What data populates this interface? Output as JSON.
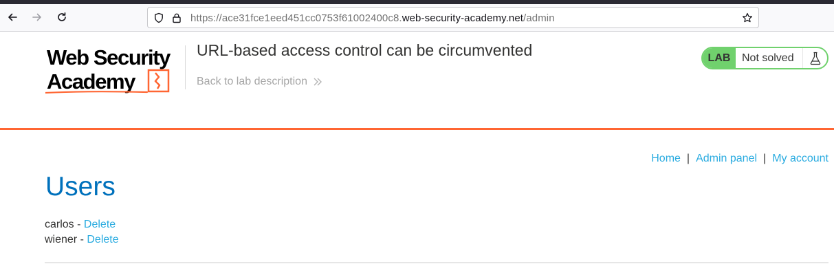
{
  "browser": {
    "url_prefix": "https://ace31fce1eed451cc0753f61002400c8.",
    "url_host": "web-security-academy.net",
    "url_path": "/admin",
    "icons": [
      "back-arrow-icon",
      "forward-arrow-icon",
      "reload-icon",
      "shield-icon",
      "lock-icon",
      "star-icon"
    ]
  },
  "header": {
    "logo_line1": "Web Security",
    "logo_line2": "Academy",
    "lab_title": "URL-based access control can be circumvented",
    "back_link": "Back to lab description",
    "status_badge": "LAB",
    "status_text": "Not solved"
  },
  "nav": {
    "home": "Home",
    "separator": "|",
    "admin": "Admin panel",
    "account": "My account"
  },
  "main": {
    "heading": "Users",
    "users": [
      {
        "name": "carlos",
        "dash": " - ",
        "action": "Delete"
      },
      {
        "name": "wiener",
        "dash": " - ",
        "action": "Delete"
      }
    ]
  },
  "colors": {
    "brand_orange": "#ff6633",
    "link_blue": "#29abe0",
    "heading_blue": "#0071bc",
    "status_green": "#70d16d"
  }
}
